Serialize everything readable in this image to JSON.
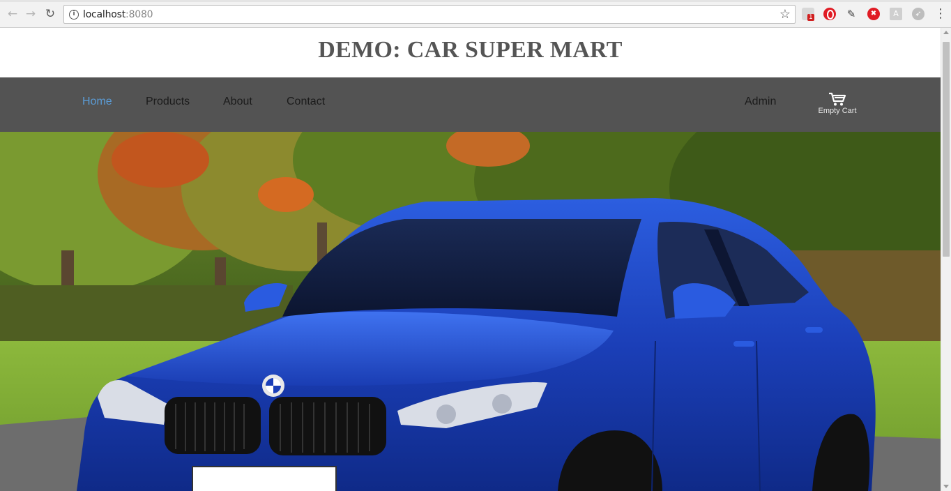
{
  "browser": {
    "url_host": "localhost",
    "url_port": ":8080",
    "extensions": {
      "shield_badge": "1"
    },
    "icons": [
      "back-arrow-icon",
      "forward-arrow-icon",
      "reload-icon",
      "info-icon",
      "star-icon",
      "shield-icon",
      "opera-icon",
      "color-picker-icon",
      "trash-icon",
      "pdf-icon",
      "rocket-icon",
      "menu-dots-icon"
    ]
  },
  "site": {
    "title": "DEMO: CAR SUPER MART"
  },
  "nav": {
    "items": [
      {
        "label": "Home",
        "active": true
      },
      {
        "label": "Products",
        "active": false
      },
      {
        "label": "About",
        "active": false
      },
      {
        "label": "Contact",
        "active": false
      }
    ],
    "admin_label": "Admin",
    "cart_label": "Empty Cart",
    "cart_icon": "shopping-cart-icon"
  },
  "colors": {
    "navbar_bg": "#535353",
    "active_link": "#5b9cd6",
    "link": "#1b1b1b",
    "title": "#555555"
  }
}
